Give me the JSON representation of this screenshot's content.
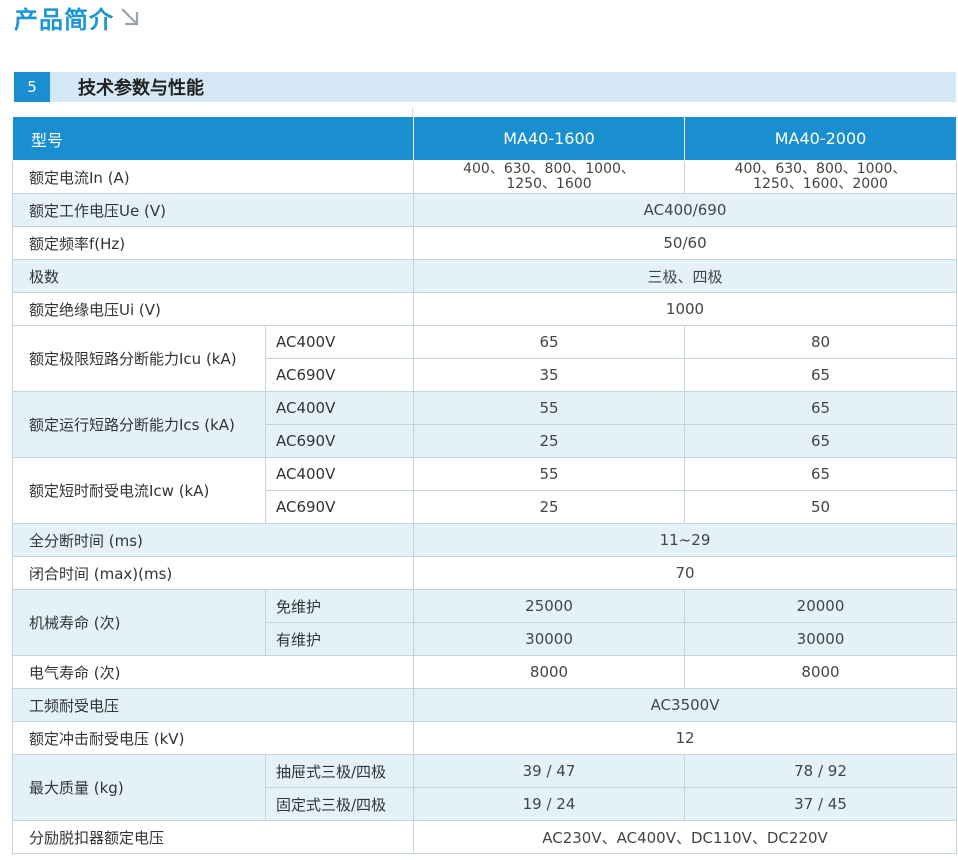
{
  "header": {
    "title": "产品简介"
  },
  "section": {
    "number": "5",
    "title": "技术参数与性能"
  },
  "table": {
    "header": {
      "label": "型号",
      "col1": "MA40-1600",
      "col2": "MA40-2000"
    },
    "rows": {
      "rated_current": {
        "label": "额定电流In (A)",
        "v1a": "400、630、800、1000、",
        "v1b": "1250、1600",
        "v2a": "400、630、800、1000、",
        "v2b": "1250、1600、2000"
      },
      "rated_voltage": {
        "label": "额定工作电压Ue (V)",
        "value": "AC400/690"
      },
      "rated_freq": {
        "label": "额定频率f(Hz)",
        "value": "50/60"
      },
      "poles": {
        "label": "极数",
        "value": "三极、四极"
      },
      "insulation": {
        "label": "额定绝缘电压Ui (V)",
        "value": "1000"
      },
      "icu": {
        "label": "额定极限短路分断能力Icu (kA)",
        "sub1": "AC400V",
        "sub2": "AC690V",
        "r1c1": "65",
        "r1c2": "80",
        "r2c1": "35",
        "r2c2": "65"
      },
      "ics": {
        "label": "额定运行短路分断能力Ics (kA)",
        "sub1": "AC400V",
        "sub2": "AC690V",
        "r1c1": "55",
        "r1c2": "65",
        "r2c1": "25",
        "r2c2": "65"
      },
      "icw": {
        "label": "额定短时耐受电流Icw (kA)",
        "sub1": "AC400V",
        "sub2": "AC690V",
        "r1c1": "55",
        "r1c2": "65",
        "r2c1": "25",
        "r2c2": "50"
      },
      "break_time": {
        "label": "全分断时间 (ms)",
        "value": "11~29"
      },
      "close_time": {
        "label": "闭合时间 (max)(ms)",
        "value": "70"
      },
      "mech_life": {
        "label": "机械寿命 (次)",
        "sub1": "免维护",
        "sub2": "有维护",
        "r1c1": "25000",
        "r1c2": "20000",
        "r2c1": "30000",
        "r2c2": "30000"
      },
      "elec_life": {
        "label": "电气寿命 (次)",
        "c1": "8000",
        "c2": "8000"
      },
      "power_freq": {
        "label": "工频耐受电压",
        "value": "AC3500V"
      },
      "impulse": {
        "label": "额定冲击耐受电压 (kV)",
        "value": "12"
      },
      "weight": {
        "label": "最大质量 (kg)",
        "sub1": "抽屉式三极/四极",
        "sub2": "固定式三极/四极",
        "r1c1": "39 / 47",
        "r1c2": "78 / 92",
        "r2c1": "19 / 24",
        "r2c2": "37 / 45"
      },
      "shunt": {
        "label": "分励脱扣器额定电压",
        "value": "AC230V、AC400V、DC110V、DC220V"
      }
    }
  }
}
